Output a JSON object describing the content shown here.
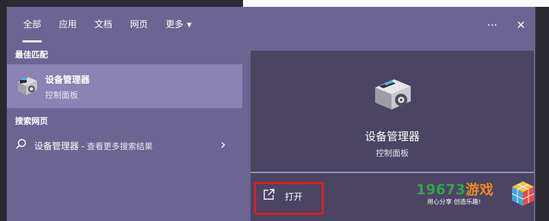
{
  "tabs": [
    {
      "label": "全部",
      "active": true
    },
    {
      "label": "应用",
      "active": false
    },
    {
      "label": "文档",
      "active": false
    },
    {
      "label": "网页",
      "active": false
    },
    {
      "label": "更多",
      "active": false
    }
  ],
  "controls": {
    "more_options": "···",
    "close": "✕"
  },
  "best_match": {
    "section_label": "最佳匹配",
    "title": "设备管理器",
    "subtitle": "控制面板",
    "icon": "device-manager-icon"
  },
  "web_search": {
    "section_label": "搜索网页",
    "query": "设备管理器",
    "suffix": " - 查看更多搜索结果"
  },
  "detail": {
    "title": "设备管理器",
    "subtitle": "控制面板",
    "open_label": "打开"
  },
  "watermark": {
    "digits": "19673",
    "game_text": "游戏",
    "slogan": "用心分享  创造乐趣!"
  },
  "colors": {
    "panel": "#6c6593",
    "selected": "#8b83b3",
    "detail": "#4b4563",
    "highlight": "#e41e1e",
    "brand_green": "#35a24a",
    "brand_orange": "#ef8a1a"
  }
}
